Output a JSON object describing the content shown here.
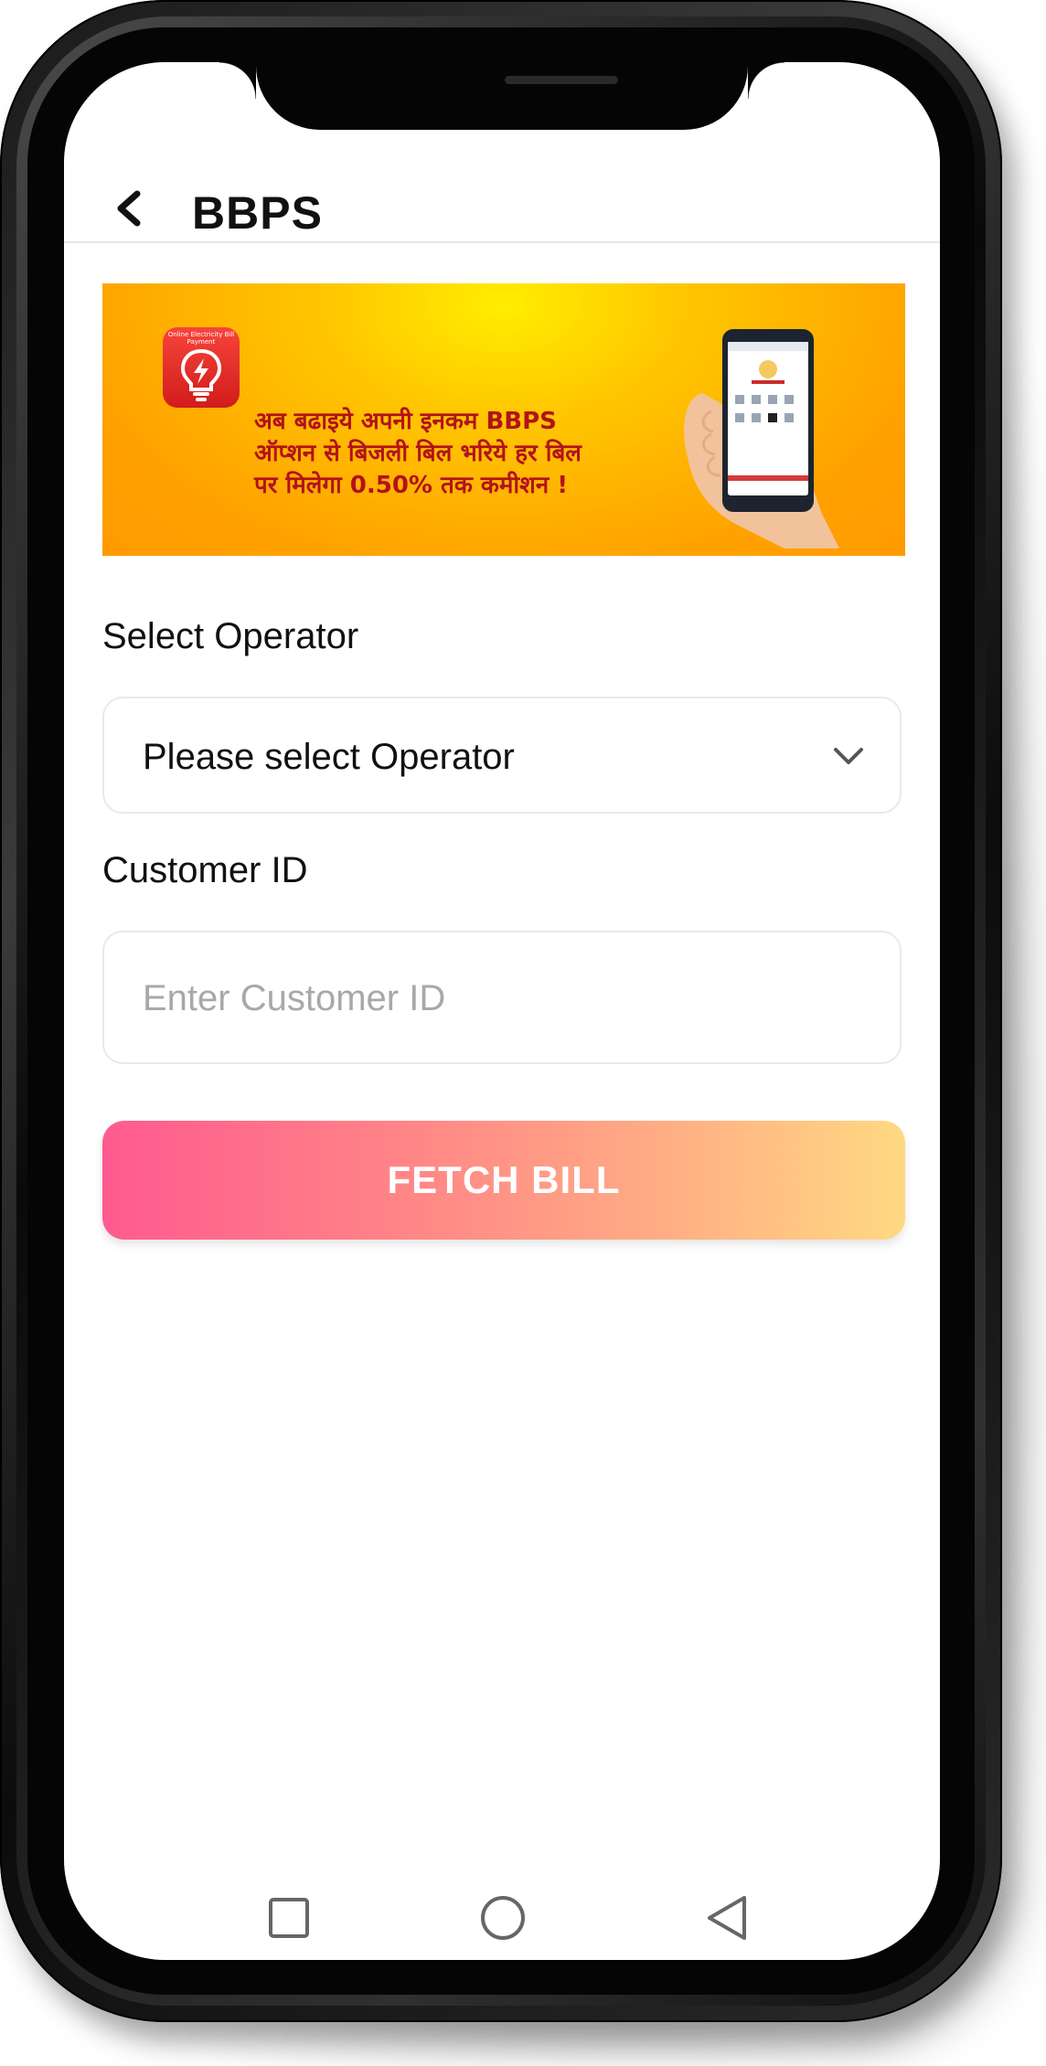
{
  "header": {
    "title": "BBPS",
    "back_icon": "chevron-left-icon"
  },
  "banner": {
    "logo_text": "Online Electricity Bill Payment",
    "promo_line1": "अब बढाइये अपनी इनकम BBPS",
    "promo_line2": "ऑप्शन से बिजली बिल भरिये हर बिल",
    "promo_line3": "पर मिलेगा 0.50% तक कमीशन !"
  },
  "form": {
    "operator_label": "Select Operator",
    "operator_value": "Please select Operator",
    "customer_label": "Customer ID",
    "customer_placeholder": "Enter Customer ID",
    "customer_value": "",
    "submit_label": "FETCH BILL"
  },
  "navigation": {
    "recent_icon": "square-icon",
    "home_icon": "circle-icon",
    "back_icon": "triangle-back-icon"
  },
  "colors": {
    "button_gradient_start": "#ff5a8f",
    "button_gradient_end": "#ffd982",
    "banner_text": "#b3121c",
    "banner_background": "#ffa200"
  }
}
